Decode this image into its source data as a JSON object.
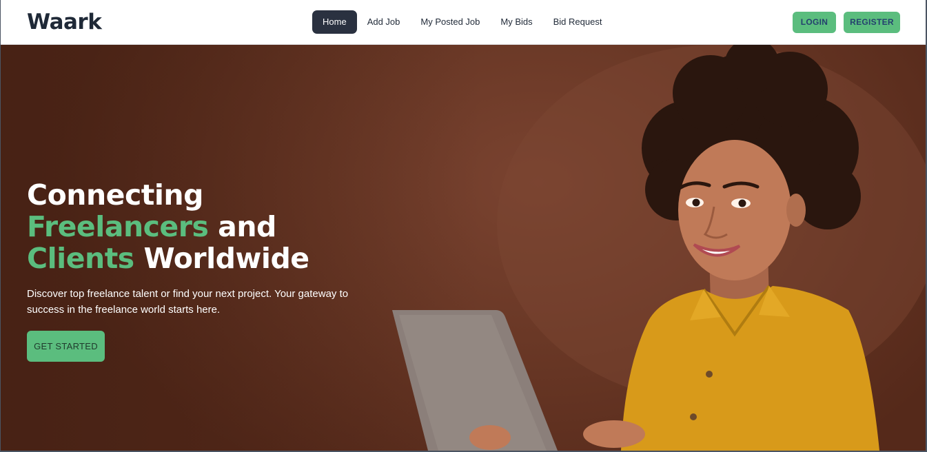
{
  "brand": {
    "logo": "Waark"
  },
  "nav": {
    "items": [
      {
        "label": "Home",
        "active": true
      },
      {
        "label": "Add Job",
        "active": false
      },
      {
        "label": "My Posted Job",
        "active": false
      },
      {
        "label": "My Bids",
        "active": false
      },
      {
        "label": "Bid Request",
        "active": false
      }
    ],
    "login_label": "LOGIN",
    "register_label": "REGISTER"
  },
  "hero": {
    "line1": "Connecting",
    "line2_accent": "Freelancers",
    "line2_rest": " and",
    "line3_accent": "Clients",
    "line3_rest": " Worldwide",
    "description": "Discover top freelance talent or find your next project. Your gateway to success in the freelance world starts here.",
    "cta_label": "GET STARTED",
    "image": "smiling-woman-with-laptop"
  },
  "colors": {
    "accent": "#5bbd7e",
    "dark": "#2a3140",
    "hero_bg": "#6a3826",
    "text_dark": "#1f2937"
  }
}
